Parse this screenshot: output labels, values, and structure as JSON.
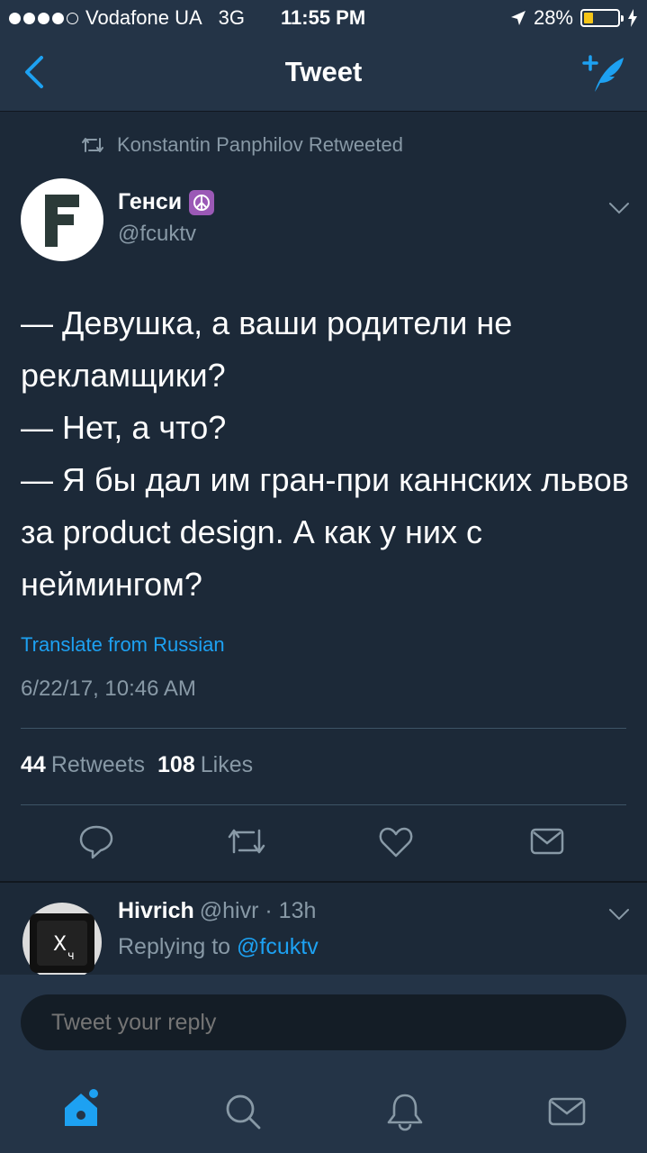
{
  "status_bar": {
    "signal_bars_filled": 4,
    "carrier": "Vodafone UA",
    "network": "3G",
    "time": "11:55 PM",
    "battery": "28%",
    "battery_level": 0.28
  },
  "nav": {
    "title": "Tweet",
    "icons": [
      "back-chevron-icon",
      "compose-tweet-icon"
    ]
  },
  "tweet": {
    "retweeted_by": "Konstantin Panphilov Retweeted",
    "author_name": "Генси",
    "author_handle": "@fcuktv",
    "text": "— Девушка, а ваши родители не рекламщики?\n— Нет, а что?\n— Я бы дал им гран-при каннских львов за product design. А как у них с неймингом?",
    "translate_label": "Translate from Russian",
    "timestamp": "6/22/17, 10:46 AM",
    "retweets_count": "44",
    "retweets_label": "Retweets",
    "likes_count": "108",
    "likes_label": "Likes"
  },
  "reply": {
    "author_name": "Hivrich",
    "author_handle": "@hivr",
    "age": "· 13h",
    "replying_prefix": "Replying to",
    "replying_to": "@fcuktv"
  },
  "composer": {
    "placeholder": "Tweet your reply"
  },
  "tabbar": {
    "items": [
      "home-icon",
      "search-icon",
      "notifications-icon",
      "messages-icon"
    ],
    "active": "home-icon"
  },
  "colors": {
    "background": "#1c2938",
    "bar": "#243447",
    "accent": "#1da1f2",
    "muted": "#8899a6"
  }
}
